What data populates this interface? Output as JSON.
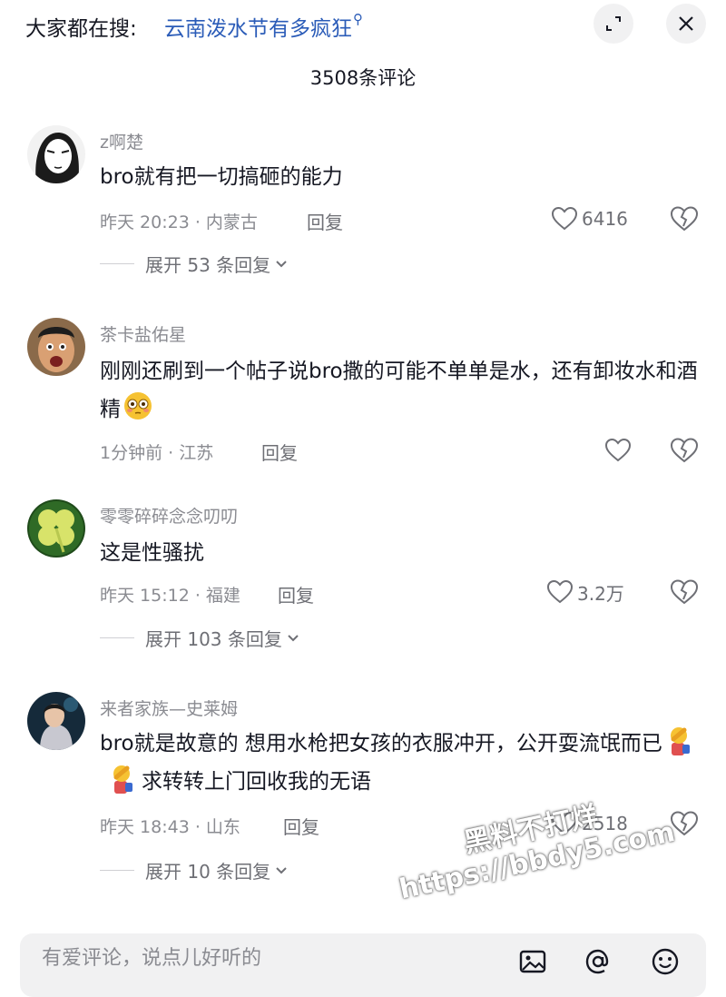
{
  "search": {
    "prefix": "大家都在搜:",
    "topic": "云南泼水节有多疯狂"
  },
  "header": {
    "title": "3508条评论"
  },
  "comments": [
    {
      "name": "z啊楚",
      "text": "bro就有把一切搞砸的能力",
      "time_location": "昨天 20:23 · 内蒙古",
      "reply_label": "回复",
      "likes": "6416",
      "expand_label": "展开 53 条回复"
    },
    {
      "name": "茶卡盐佑星",
      "text": "刚刚还刷到一个帖子说bro撒的可能不单单是水，还有卸妆水和酒精",
      "time_location": "1分钟前 · 江苏",
      "reply_label": "回复",
      "likes": ""
    },
    {
      "name": "零零碎碎念念叨叨",
      "text": "这是性骚扰",
      "time_location": "昨天 15:12 · 福建",
      "reply_label": "回复",
      "likes": "3.2万",
      "expand_label": "展开 103 条回复"
    },
    {
      "name": "来者家族—史莱姆",
      "text_part1": "bro就是故意的  想用水枪把女孩的衣服冲开，公开耍流氓而已",
      "text_part2": "求转转上门回收我的无语",
      "time_location": "昨天 18:43 · 山东",
      "reply_label": "回复",
      "likes": "2518",
      "expand_label": "展开 10 条回复"
    }
  ],
  "input": {
    "placeholder": "有爱评论，说点儿好听的"
  },
  "watermark": {
    "line1": "黑料不打烊",
    "line2": "https://bbdy5.com"
  },
  "colors": {
    "topic_link": "#2b5cb8",
    "secondary_text": "#8a8b91",
    "primary_text": "#161823"
  }
}
